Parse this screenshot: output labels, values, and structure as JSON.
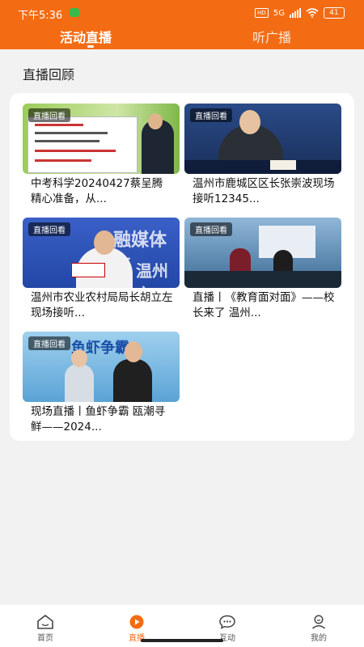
{
  "status_bar": {
    "time": "下午5:36",
    "network": "5G",
    "battery": "41",
    "hd": "HD"
  },
  "tabs": [
    {
      "label": "活动直播",
      "active": true
    },
    {
      "label": "听广播",
      "active": false
    }
  ],
  "section_title": "直播回顾",
  "colors": {
    "accent": "#f36c14",
    "background": "#f2f2f2"
  },
  "items": [
    {
      "badge": "直播回看",
      "title": "中考科学20240427蔡呈腾 精心准备，从..."
    },
    {
      "badge": "直播回看",
      "title": "温州市鹿城区区长张崇波现场接听12345..."
    },
    {
      "badge": "直播回看",
      "title": "温州市农业农村局局长胡立左现场接听..."
    },
    {
      "badge": "直播回看",
      "title": "直播丨《教育面对面》——校长来了 温州..."
    },
    {
      "badge": "直播回看",
      "title": "现场直播丨鱼虾争霸 瓯潮寻鲜——2024..."
    }
  ],
  "thumb_text": {
    "item3_line1": "融媒体直",
    "item3_line2": "温州市",
    "item5_banner": "鱼虾争霸"
  },
  "bottom_nav": [
    {
      "label": "首页",
      "icon": "home-icon"
    },
    {
      "label": "直播",
      "icon": "live-icon",
      "active": true
    },
    {
      "label": "互动",
      "icon": "chat-icon"
    },
    {
      "label": "我的",
      "icon": "user-icon"
    }
  ]
}
